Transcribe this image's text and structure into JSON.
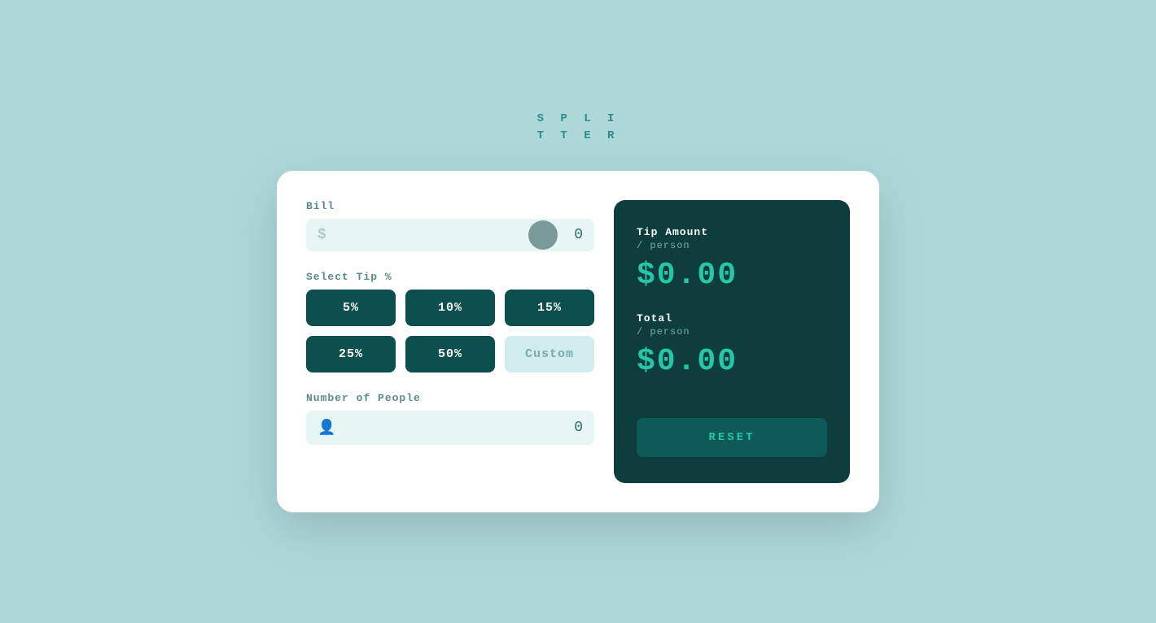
{
  "app": {
    "title_line1": "S P L I",
    "title_line2": "T T E R"
  },
  "left": {
    "bill_label": "Bill",
    "currency": "$",
    "bill_value": "0",
    "bill_placeholder": "",
    "tip_label": "Select Tip %",
    "tip_buttons": [
      {
        "label": "5%",
        "active": true
      },
      {
        "label": "10%",
        "active": true
      },
      {
        "label": "15%",
        "active": true
      },
      {
        "label": "25%",
        "active": true
      },
      {
        "label": "50%",
        "active": true
      },
      {
        "label": "Custom",
        "active": false
      }
    ],
    "people_label": "Number of People",
    "people_value": "0"
  },
  "right": {
    "tip_amount_label": "Tip Amount",
    "tip_per_person": "/ person",
    "tip_value": "$0.00",
    "total_label": "Total",
    "total_per_person": "/ person",
    "total_value": "$0.00",
    "reset_label": "RESET"
  }
}
